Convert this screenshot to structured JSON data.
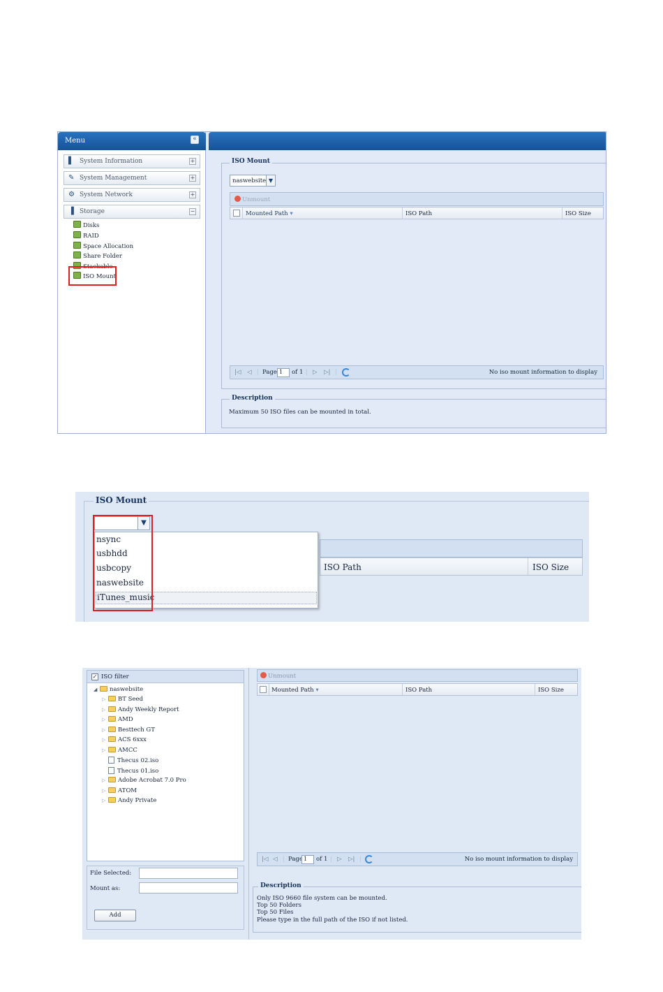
{
  "shot1": {
    "menu": {
      "title": "Menu",
      "collapse_icon": "«",
      "sections": [
        {
          "label": "System Information",
          "toggle": "+"
        },
        {
          "label": "System Management",
          "toggle": "+"
        },
        {
          "label": "System Network",
          "toggle": "+"
        },
        {
          "label": "Storage",
          "toggle": "−"
        }
      ],
      "storage_items": [
        "Disks",
        "RAID",
        "Space Allocation",
        "Share Folder",
        "Stackable",
        "ISO Mount"
      ]
    },
    "iso_mount": {
      "legend": "ISO Mount",
      "share_select": "naswebsite",
      "unmount_label": "Unmount",
      "columns": [
        "Mounted Path",
        "ISO Path",
        "ISO Size"
      ],
      "pager": {
        "page_label": "Page",
        "page_value": "1",
        "of_label": "of 1",
        "status": "No iso mount information to display"
      }
    },
    "description": {
      "legend": "Description",
      "text": "Maximum 50 ISO files can be mounted in total."
    }
  },
  "shot2": {
    "legend": "ISO Mount",
    "dropdown_options": [
      "nsync",
      "usbhdd",
      "usbcopy",
      "naswebsite",
      "iTunes_music"
    ],
    "selected_option": "iTunes_music",
    "columns": [
      "ISO Path",
      "ISO Size"
    ]
  },
  "shot3": {
    "iso_filter_label": "ISO filter",
    "tree_root": "naswebsite",
    "tree_items": [
      {
        "type": "folder",
        "name": "BT Seed"
      },
      {
        "type": "folder",
        "name": "Andy Weekly Report"
      },
      {
        "type": "folder",
        "name": "AMD"
      },
      {
        "type": "folder",
        "name": "Besttech GT"
      },
      {
        "type": "folder",
        "name": "ACS 6xxx"
      },
      {
        "type": "folder",
        "name": "AMCC"
      },
      {
        "type": "file",
        "name": "Thecus 02.iso"
      },
      {
        "type": "file",
        "name": "Thecus 01.iso"
      },
      {
        "type": "folder",
        "name": "Adobe Acrobat 7.0 Pro"
      },
      {
        "type": "folder",
        "name": "ATOM"
      },
      {
        "type": "folder",
        "name": "Andy Private"
      }
    ],
    "file_selected_label": "File Selected:",
    "mount_as_label": "Mount as:",
    "add_label": "Add",
    "unmount_label": "Unmount",
    "columns": [
      "Mounted Path",
      "ISO Path",
      "ISO Size"
    ],
    "pager": {
      "page_label": "Page",
      "page_value": "1",
      "of_label": "of 1",
      "status": "No iso mount information to display"
    },
    "description": {
      "legend": "Description",
      "lines": [
        "Only ISO 9660 file system can be mounted.",
        "Top 50 Folders",
        "Top 50 Files",
        "Please type in the full path of the ISO if not listed."
      ]
    }
  }
}
